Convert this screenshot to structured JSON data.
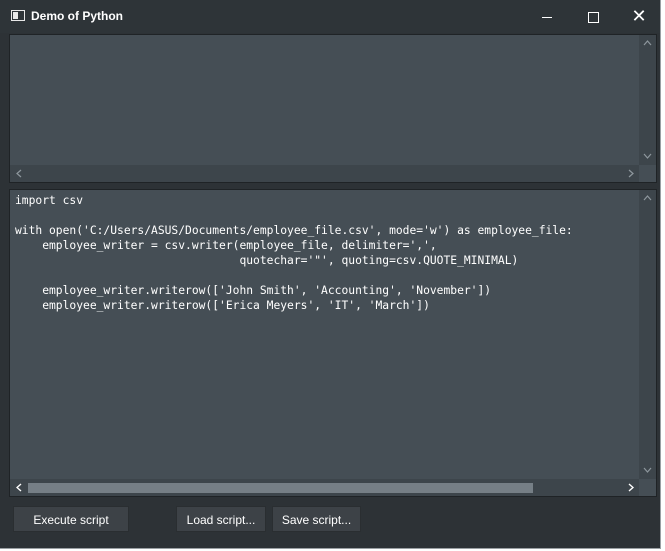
{
  "window": {
    "title": "Demo of Python"
  },
  "editor": {
    "lines": [
      "import csv",
      "",
      "with open('C:/Users/ASUS/Documents/employee_file.csv', mode='w') as employee_file:",
      "    employee_writer = csv.writer(employee_file, delimiter=',',",
      "                                 quotechar='\"', quoting=csv.QUOTE_MINIMAL)",
      "",
      "    employee_writer.writerow(['John Smith', 'Accounting', 'November'])",
      "    employee_writer.writerow(['Erica Meyers', 'IT', 'March'])"
    ]
  },
  "buttons": {
    "execute": "Execute script",
    "load": "Load script...",
    "save": "Save script..."
  },
  "colors": {
    "window_bg": "#2d3236",
    "pane_bg": "#454e55",
    "text": "#ffffff"
  }
}
